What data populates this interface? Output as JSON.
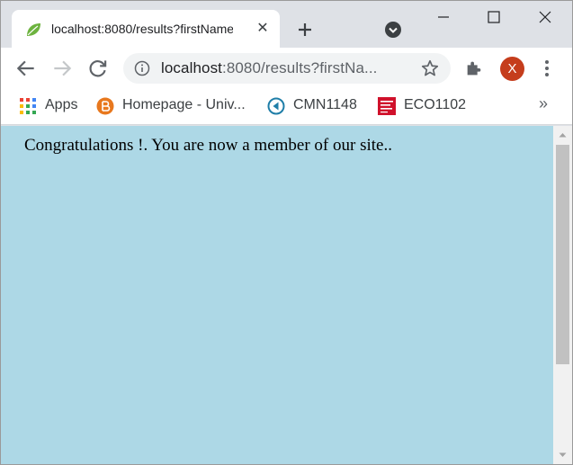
{
  "tab": {
    "title": "localhost:8080/results?firstName",
    "favicon": "spring-leaf-icon"
  },
  "window_controls": [
    "minimize-icon",
    "maximize-icon",
    "close-icon"
  ],
  "toolbar": {
    "url_host": "localhost",
    "url_rest": ":8080/results?firstNa...",
    "profile_initial": "X",
    "profile_color": "#c53d1c"
  },
  "bookmarks": {
    "items": [
      {
        "label": "Apps",
        "icon": "apps-grid-icon"
      },
      {
        "label": "Homepage - Univ...",
        "icon": "brightspace-icon"
      },
      {
        "label": "CMN1148",
        "icon": "course-arrow-icon"
      },
      {
        "label": "ECO1102",
        "icon": "mcgraw-hill-icon"
      }
    ],
    "more": "»"
  },
  "page": {
    "message": "Congratulations !. You are now a member of our site..",
    "background": "#add8e6"
  }
}
